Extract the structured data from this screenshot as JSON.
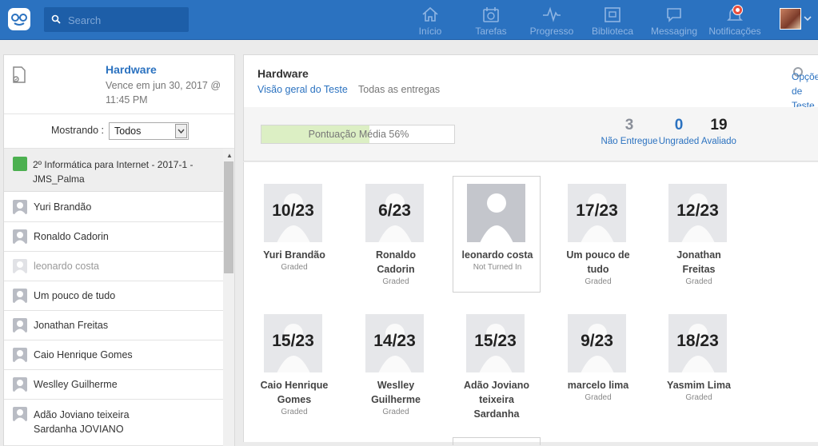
{
  "search": {
    "placeholder": "Search"
  },
  "nav": [
    {
      "icon": "home-icon",
      "label": "Início"
    },
    {
      "icon": "calendar-check-icon",
      "label": "Tarefas"
    },
    {
      "icon": "pulse-icon",
      "label": "Progresso"
    },
    {
      "icon": "library-icon",
      "label": "Biblioteca"
    },
    {
      "icon": "chat-bubble-icon",
      "label": "Messaging"
    },
    {
      "icon": "bell-icon",
      "label": "Notificações"
    }
  ],
  "sidebar": {
    "title": "Hardware",
    "due": "Vence em jun 30, 2017 @ 11:45 PM",
    "showing_label": "Mostrando :",
    "showing_value": "Todos",
    "group": "2º Informática para Internet - 2017-1 - JMS_Palma",
    "students": [
      "Yuri Brandão",
      "Ronaldo Cadorin",
      "leonardo costa",
      "Um pouco de tudo",
      "Jonathan Freitas",
      "Caio Henrique Gomes",
      "Weslley Guilherme",
      "Adão Joviano teixeira Sardanha JOVIANO"
    ]
  },
  "main": {
    "title": "Hardware",
    "tab_overview": "Visão geral do Teste",
    "tab_submissions": "Todas as entregas",
    "options": "Opções de Teste",
    "average_label": "Pontuação Média 56%",
    "average_percent": 56
  },
  "stats": [
    {
      "value": "3",
      "label": "Não Entregue",
      "color": "#8a8f99"
    },
    {
      "value": "0",
      "label": "Ungraded",
      "color": "#2b72c0"
    },
    {
      "value": "19",
      "label": "Avaliado",
      "color": "#222222"
    }
  ],
  "cards": [
    {
      "score": "10/23",
      "name": "Yuri Brandão",
      "status": "Graded"
    },
    {
      "score": "6/23",
      "name": "Ronaldo Cadorin",
      "status": "Graded"
    },
    {
      "score": "",
      "name": "leonardo costa",
      "status": "Not Turned In"
    },
    {
      "score": "17/23",
      "name": "Um pouco de tudo",
      "status": "Graded"
    },
    {
      "score": "12/23",
      "name": "Jonathan Freitas",
      "status": "Graded"
    },
    {
      "score": "15/23",
      "name": "Caio Henrique Gomes",
      "status": "Graded"
    },
    {
      "score": "14/23",
      "name": "Weslley Guilherme",
      "status": "Graded"
    },
    {
      "score": "15/23",
      "name": "Adão Joviano teixeira Sardanha",
      "status": ""
    },
    {
      "score": "9/23",
      "name": "marcelo lima",
      "status": "Graded"
    },
    {
      "score": "18/23",
      "name": "Yasmim Lima",
      "status": "Graded"
    }
  ]
}
